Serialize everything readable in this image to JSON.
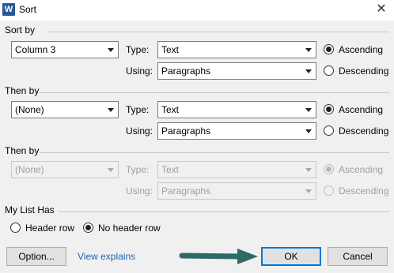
{
  "window": {
    "icon_letter": "W",
    "title": "Sort",
    "close_glyph": "✕"
  },
  "sort_by": {
    "heading": "Sort by",
    "column": "Column 3",
    "type_label": "Type:",
    "type": "Text",
    "using_label": "Using:",
    "using": "Paragraphs",
    "ascending": "Ascending",
    "descending": "Descending",
    "order": "ascending"
  },
  "then_by_1": {
    "heading": "Then by",
    "column": "(None)",
    "type_label": "Type:",
    "type": "Text",
    "using_label": "Using:",
    "using": "Paragraphs",
    "ascending": "Ascending",
    "descending": "Descending",
    "order": "ascending"
  },
  "then_by_2": {
    "heading": "Then by",
    "column": "(None)",
    "type_label": "Type:",
    "type": "Text",
    "using_label": "Using:",
    "using": "Paragraphs",
    "ascending": "Ascending",
    "descending": "Descending",
    "order": "ascending",
    "disabled": true
  },
  "list_has": {
    "heading": "My List Has",
    "header_row": "Header row",
    "no_header_row": "No header row",
    "selected": "no_header_row"
  },
  "buttons": {
    "options": "Option...",
    "link": "View explains",
    "ok": "OK",
    "cancel": "Cancel"
  },
  "colors": {
    "accent": "#0078d7",
    "link": "#1a66b8",
    "arrow": "#2e6b67"
  }
}
